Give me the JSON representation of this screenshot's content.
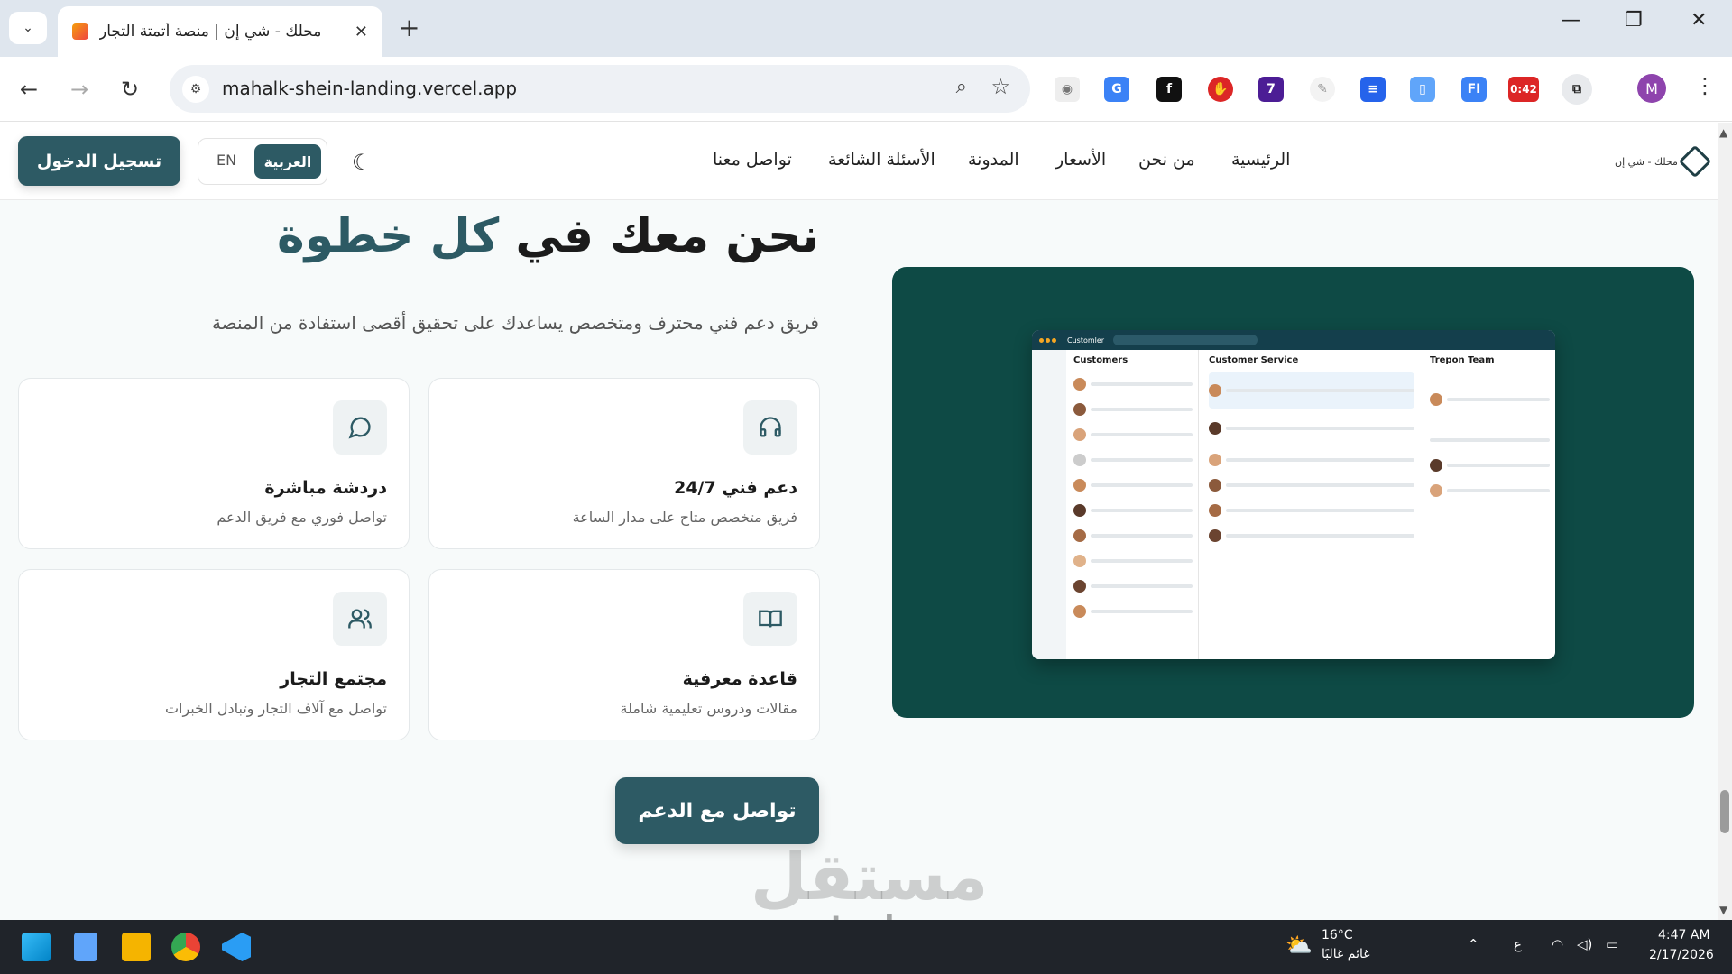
{
  "browser": {
    "tab_title": "محلك - شي إن | منصة أتمتة التجار",
    "tab_close": "✕",
    "new_tab": "+",
    "url": "mahalk-shein-landing.vercel.app",
    "ext_timer": "0:42",
    "ext_badge": "7",
    "profile_initial": "M"
  },
  "site": {
    "logo_text": "محلك - شي إن",
    "nav": [
      "الرئيسية",
      "من نحن",
      "الأسعار",
      "المدونة",
      "الأسئلة الشائعة",
      "تواصل معنا"
    ],
    "lang_en": "EN",
    "lang_ar": "العربية",
    "login": "تسجيل الدخول"
  },
  "hero": {
    "title_a": "نحن معك ",
    "title_b": "في",
    "title_c": " كل خطوة",
    "subtitle": "فريق دعم فني محترف ومتخصص يساعدك على تحقيق أقصى استفادة من المنصة"
  },
  "cards": [
    {
      "title": "دعم فني 24/7",
      "desc": "فريق متخصص متاح على مدار الساعة",
      "icon": "headphones-icon"
    },
    {
      "title": "دردشة مباشرة",
      "desc": "تواصل فوري مع فريق الدعم",
      "icon": "chat-icon"
    },
    {
      "title": "قاعدة معرفية",
      "desc": "مقالات ودروس تعليمية شاملة",
      "icon": "book-icon"
    },
    {
      "title": "مجتمع التجار",
      "desc": "تواصل مع آلاف التجار وتبادل الخبرات",
      "icon": "users-icon"
    }
  ],
  "cta": "تواصل مع الدعم",
  "mockup": {
    "app": "Customler",
    "col_a_title": "Customers",
    "col_b_title": "Customer Service",
    "col_c_title": "Trepon Team"
  },
  "watermark": {
    "ar": "مستقل",
    "en": "mostaql.com"
  },
  "taskbar": {
    "temp": "16°C",
    "weather": "غائم غالبًا",
    "ime": "ع",
    "time": "4:47 AM",
    "date": "2/17/2026"
  },
  "colors": {
    "brand": "#2d5a64",
    "panel": "#0e4a45"
  }
}
